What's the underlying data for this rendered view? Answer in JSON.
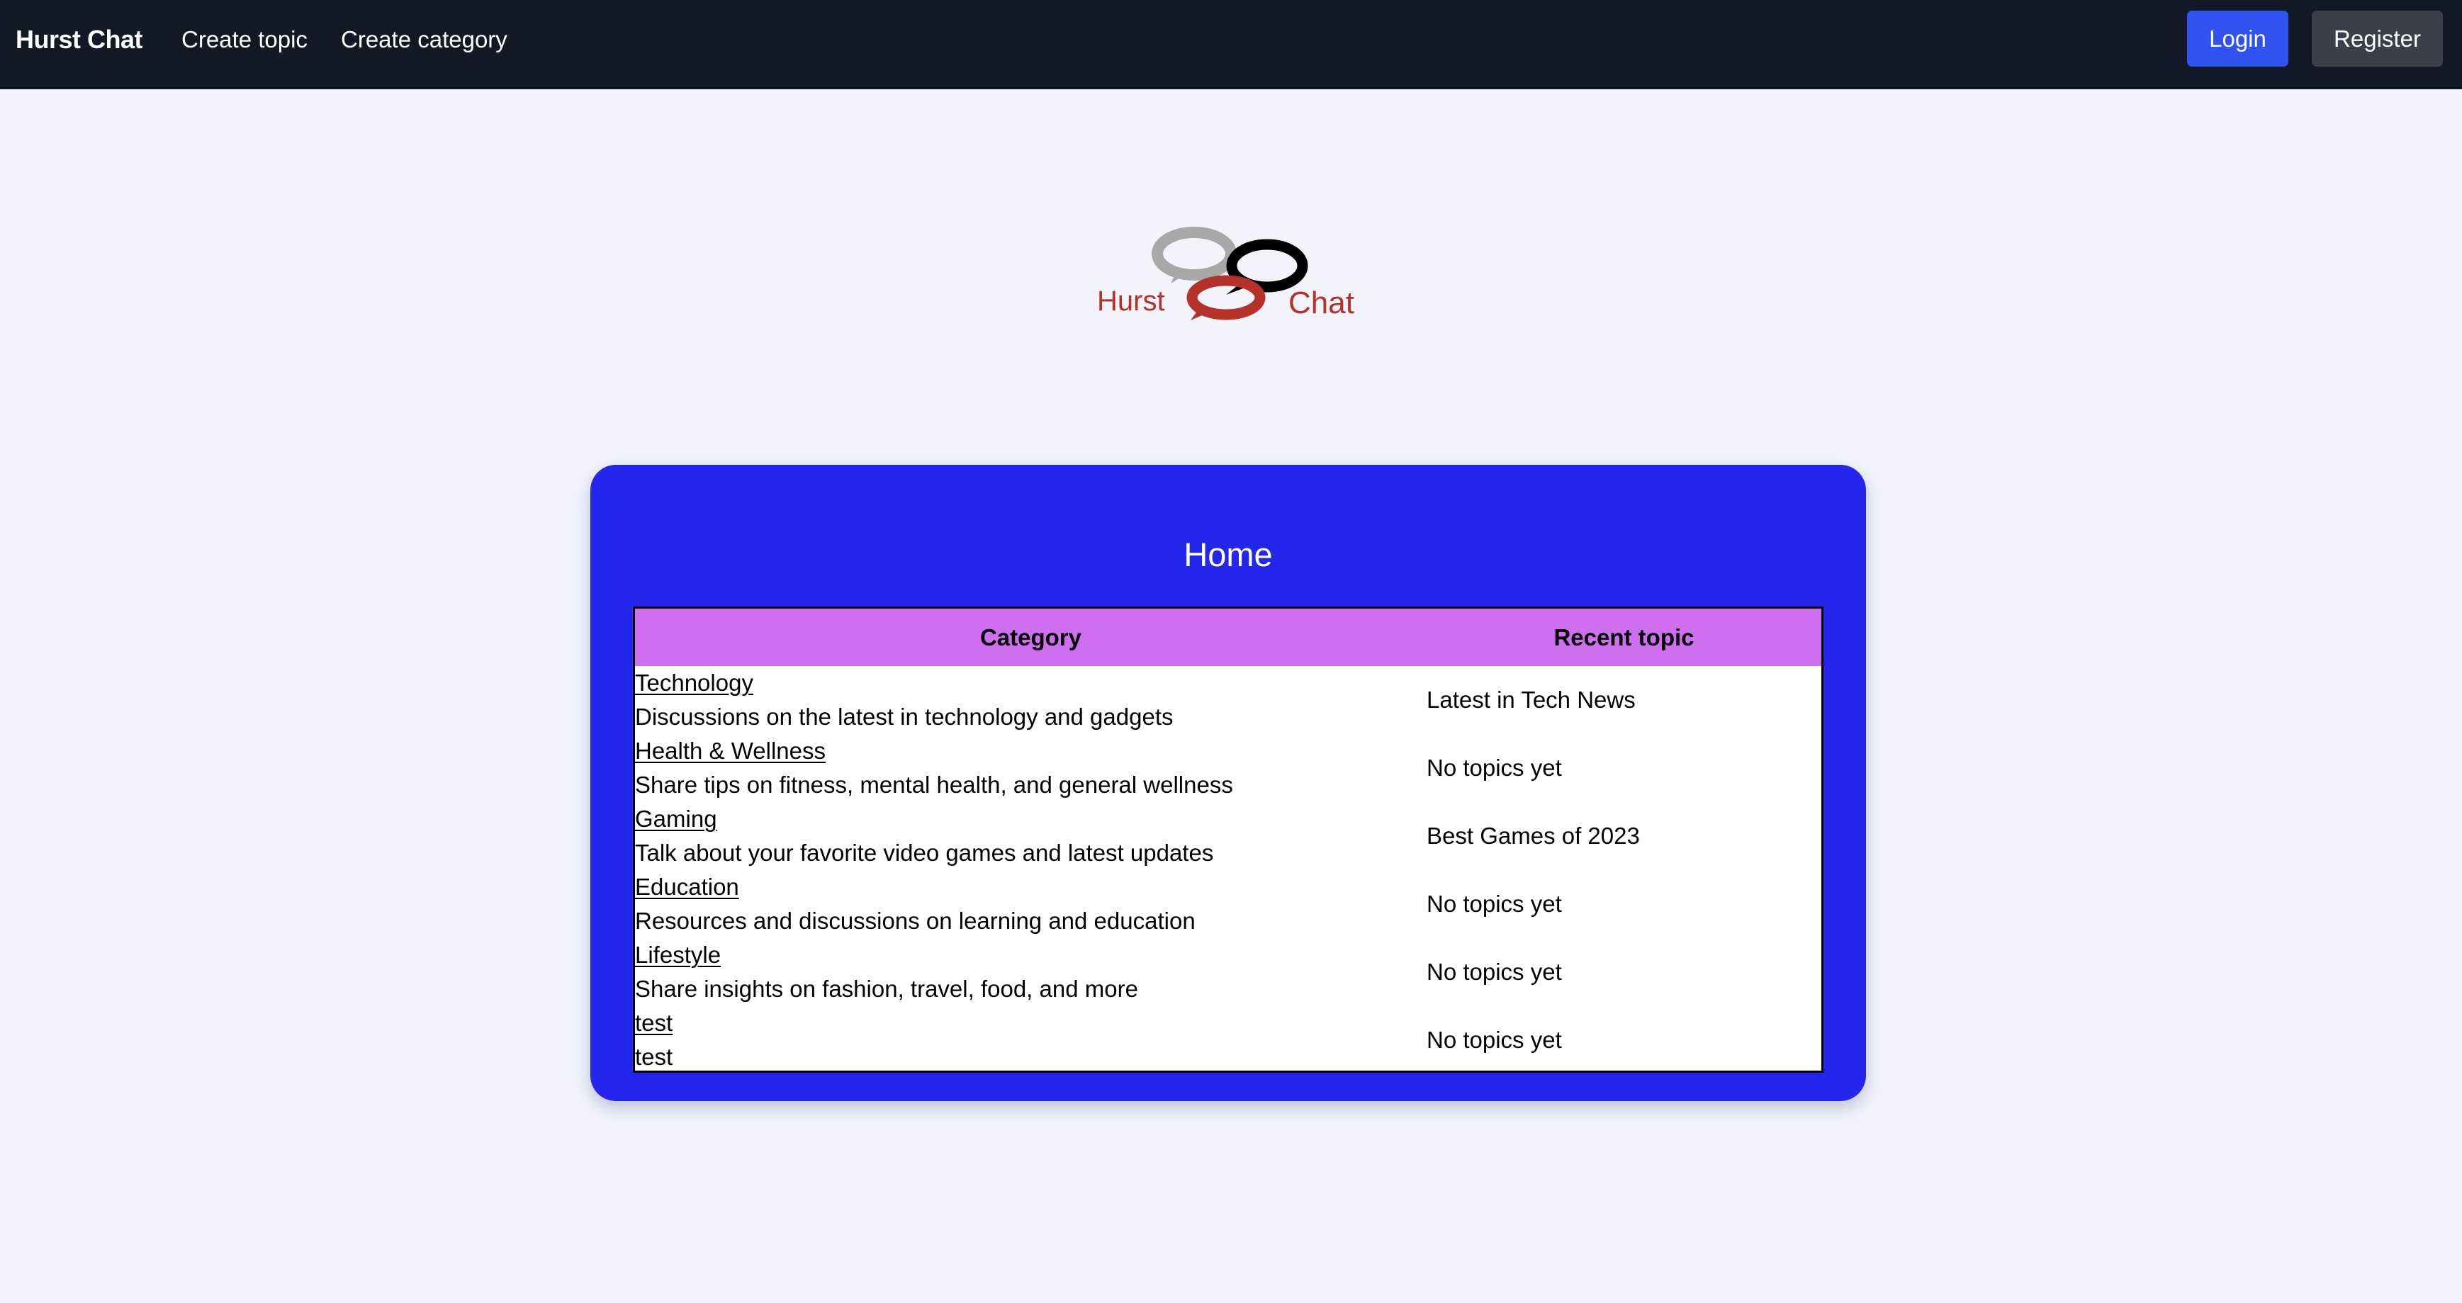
{
  "navbar": {
    "brand": "Hurst Chat",
    "links": [
      "Create topic",
      "Create category"
    ],
    "login_label": "Login",
    "register_label": "Register"
  },
  "logo": {
    "left_text": "Hurst",
    "right_text": "Chat",
    "colors": {
      "grey_bubble": "#a8a8a8",
      "black_bubble": "#000000",
      "red_bubble": "#b5322b",
      "text": "#b5322b"
    }
  },
  "card": {
    "title": "Home",
    "background": "#2426ec",
    "header_background": "#cf6ff0",
    "columns": [
      "Category",
      "Recent topic"
    ],
    "rows": [
      {
        "name": "Technology",
        "description": "Discussions on the latest in technology and gadgets",
        "recent": "Latest in Tech News"
      },
      {
        "name": "Health & Wellness",
        "description": "Share tips on fitness, mental health, and general wellness",
        "recent": "No topics yet"
      },
      {
        "name": "Gaming",
        "description": "Talk about your favorite video games and latest updates",
        "recent": "Best Games of 2023"
      },
      {
        "name": "Education",
        "description": "Resources and discussions on learning and education",
        "recent": "No topics yet"
      },
      {
        "name": "Lifestyle",
        "description": "Share insights on fashion, travel, food, and more",
        "recent": "No topics yet"
      },
      {
        "name": "test",
        "description": "test",
        "recent": "No topics yet"
      }
    ]
  }
}
